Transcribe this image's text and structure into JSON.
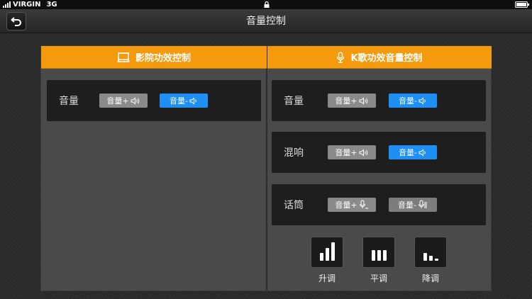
{
  "status_bar": {
    "carrier": "VIRGIN",
    "network": "3G"
  },
  "nav": {
    "title": "音量控制"
  },
  "cinema": {
    "header": "影院功效控制",
    "rows": [
      {
        "label": "音量",
        "plus": "音量+",
        "minus": "音量-"
      }
    ]
  },
  "karaoke": {
    "header": "K歌功效音量控制",
    "rows": [
      {
        "label": "音量",
        "plus": "音量+",
        "minus": "音量-"
      },
      {
        "label": "混响",
        "plus": "音量+",
        "minus": "音量-"
      },
      {
        "label": "话筒",
        "plus": "音量+",
        "minus": "音量-"
      }
    ],
    "tune": [
      {
        "label": "升调"
      },
      {
        "label": "平调"
      },
      {
        "label": "降调"
      }
    ]
  },
  "colors": {
    "accent": "#f59a0c",
    "blue_button": "#1d8ff5",
    "gray_button": "#8a8a8a"
  },
  "icons": [
    "back-icon",
    "screen-icon",
    "microphone-icon",
    "speaker-icon",
    "signal-bars-icon",
    "lock-icon",
    "battery-icon"
  ]
}
